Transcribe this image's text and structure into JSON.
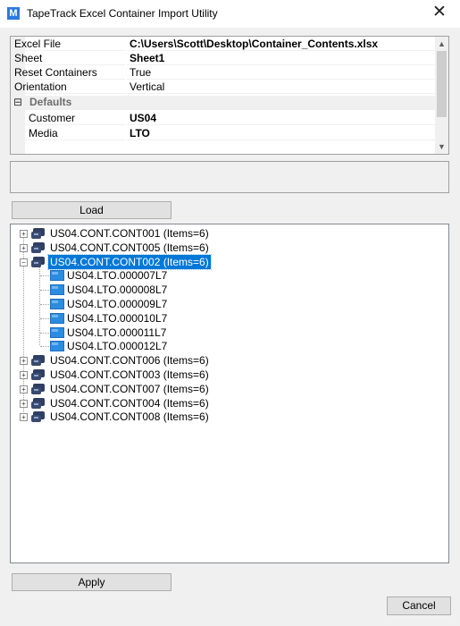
{
  "window": {
    "title": "TapeTrack Excel Container Import Utility",
    "close_glyph": "✕",
    "icon_letter": "M"
  },
  "grid": {
    "rows": [
      {
        "name": "Excel File",
        "value": "C:\\Users\\Scott\\Desktop\\Container_Contents.xlsx",
        "bold": true
      },
      {
        "name": "Sheet",
        "value": "Sheet1",
        "bold": true
      },
      {
        "name": "Reset Containers",
        "value": "True",
        "bold": false
      },
      {
        "name": "Orientation",
        "value": "Vertical",
        "bold": false
      }
    ],
    "category": {
      "label": "Defaults",
      "toggle": "⊟"
    },
    "sub_rows": [
      {
        "name": "Customer",
        "value": "US04",
        "bold": true
      },
      {
        "name": "Media",
        "value": "LTO",
        "bold": true
      }
    ]
  },
  "buttons": {
    "load": "Load",
    "apply": "Apply",
    "cancel": "Cancel"
  },
  "tree": {
    "containers_before": [
      {
        "label": "US04.CONT.CONT001 (Items=6)"
      },
      {
        "label": "US04.CONT.CONT005 (Items=6)"
      }
    ],
    "selected": {
      "label": "US04.CONT.CONT002 (Items=6)"
    },
    "children": [
      "US04.LTO.000007L7",
      "US04.LTO.000008L7",
      "US04.LTO.000009L7",
      "US04.LTO.000010L7",
      "US04.LTO.000011L7",
      "US04.LTO.000012L7"
    ],
    "containers_after": [
      {
        "label": "US04.CONT.CONT006 (Items=6)"
      },
      {
        "label": "US04.CONT.CONT003 (Items=6)"
      },
      {
        "label": "US04.CONT.CONT007 (Items=6)"
      },
      {
        "label": "US04.CONT.CONT004 (Items=6)"
      },
      {
        "label": "US04.CONT.CONT008 (Items=6)"
      }
    ]
  },
  "colors": {
    "selection": "#0078d7",
    "container_icon": "#2f3e63",
    "tape_icon": "#2a8de0"
  }
}
